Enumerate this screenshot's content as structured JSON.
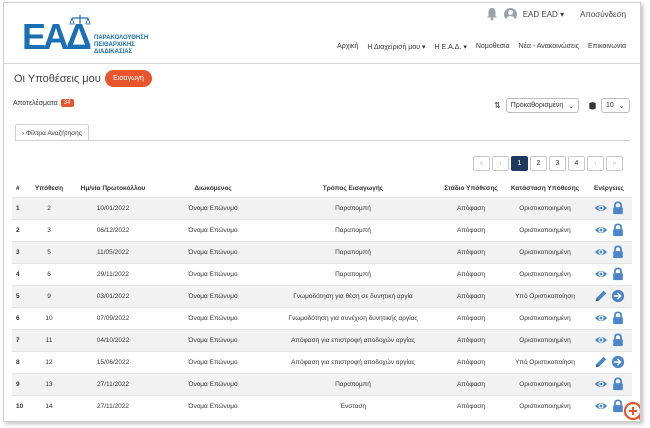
{
  "header": {
    "logo": {
      "letters": "ΕΑΔ",
      "text": [
        "ΠΑΡΑΚΟΛΟΥΘΗΣΗ",
        "ΠΕΙΘΑΡΧΙΚΗΣ",
        "ΔΙΑΔΙΚΑΣΙΑΣ"
      ]
    },
    "user": "EAD EAD",
    "logout": "Αποσύνδεση",
    "nav": [
      "Αρχική",
      "Η Διαχείρισή μου",
      "Η Ε.Α.Δ.",
      "Νομοθεσία",
      "Νέα - Ανακοινώσεις",
      "Επικοινωνία"
    ]
  },
  "page": {
    "title": "Οι Υποθέσεις μου",
    "import_button": "Εισαγωγή",
    "results_label": "Αποτελέσματα",
    "results_count": "34",
    "sort_value": "Προκαθορισμένη",
    "per_page_value": "10",
    "filter_tab": "Φίλτρα Αναζήτησης"
  },
  "pagination": {
    "first": "«",
    "prev": "‹",
    "pages": [
      "1",
      "2",
      "3",
      "4"
    ],
    "active": "1",
    "next": "›",
    "last": "»"
  },
  "table": {
    "headers": [
      "#",
      "Υπόθεση",
      "Ημ/νία Πρωτοκόλλου",
      "Διωκόμενος",
      "Τρόπος Εισαγωγής",
      "Στάδιο Υπόθεσης",
      "Κατάσταση Υπόθεσης",
      "Ενέργειες"
    ],
    "rows": [
      {
        "n": "1",
        "case": "2",
        "date": "10/01/2022",
        "person": "Όνομα Επώνυμο",
        "method": "Παραπομπή",
        "stage": "Απόφαση",
        "status": "Οριστικοποιημένη",
        "actions": [
          "view",
          "lock"
        ]
      },
      {
        "n": "2",
        "case": "3",
        "date": "06/12/2022",
        "person": "Όνομα Επώνυμο",
        "method": "Παραπομπή",
        "stage": "Απόφαση",
        "status": "Οριστικοποιημένη",
        "actions": [
          "view",
          "lock"
        ]
      },
      {
        "n": "3",
        "case": "5",
        "date": "11/05/2022",
        "person": "Όνομα Επώνυμο",
        "method": "Παραπομπή",
        "stage": "Απόφαση",
        "status": "Οριστικοποιημένη",
        "actions": [
          "view",
          "lock"
        ]
      },
      {
        "n": "4",
        "case": "6",
        "date": "29/11/2022",
        "person": "Όνομα Επώνυμο",
        "method": "Παραπομπή",
        "stage": "Απόφαση",
        "status": "Οριστικοποιημένη",
        "actions": [
          "view",
          "lock"
        ]
      },
      {
        "n": "5",
        "case": "9",
        "date": "03/01/2022",
        "person": "Όνομα Επώνυμο",
        "method": "Γνωμοδότηση για θέση σε δυνητική αργία",
        "stage": "Απόφαση",
        "status": "Υπό Οριστικοποίηση",
        "actions": [
          "edit",
          "go"
        ]
      },
      {
        "n": "6",
        "case": "10",
        "date": "07/09/2022",
        "person": "Όνομα Επώνυμο",
        "method": "Γνωμοδότηση για συνέχιση δυνητικής αργίας",
        "stage": "Απόφαση",
        "status": "Οριστικοποιημένη",
        "actions": [
          "view",
          "lock"
        ]
      },
      {
        "n": "7",
        "case": "11",
        "date": "04/10/2022",
        "person": "Όνομα Επώνυμο",
        "method": "Απόφαση για επιστροφή αποδοχών αργίας",
        "stage": "Απόφαση",
        "status": "Οριστικοποιημένη",
        "actions": [
          "view",
          "lock"
        ]
      },
      {
        "n": "8",
        "case": "12",
        "date": "15/06/2022",
        "person": "Όνομα Επώνυμο",
        "method": "Απόφαση για επιστροφή αποδοχών αργίας",
        "stage": "Απόφαση",
        "status": "Υπό Οριστικοποίηση",
        "actions": [
          "edit",
          "go"
        ]
      },
      {
        "n": "9",
        "case": "13",
        "date": "27/11/2022",
        "person": "Όνομα Επώνυμο",
        "method": "Παραπομπή",
        "stage": "Απόφαση",
        "status": "Οριστικοποιημένη",
        "actions": [
          "view",
          "lock"
        ]
      },
      {
        "n": "10",
        "case": "14",
        "date": "27/11/2022",
        "person": "Όνομα Επώνυμο",
        "method": "Ένσταση",
        "stage": "Απόφαση",
        "status": "Οριστικοποιημένη",
        "actions": [
          "view",
          "lock"
        ]
      }
    ]
  },
  "colors": {
    "accent": "#e8552d",
    "brand_blue": "#1b6fb5",
    "icon_blue": "#4a86c8",
    "pager_active": "#1f3a5f"
  },
  "icons": {
    "notification": "bell-icon",
    "user": "avatar-icon",
    "zoom": "zoom-in-icon"
  }
}
